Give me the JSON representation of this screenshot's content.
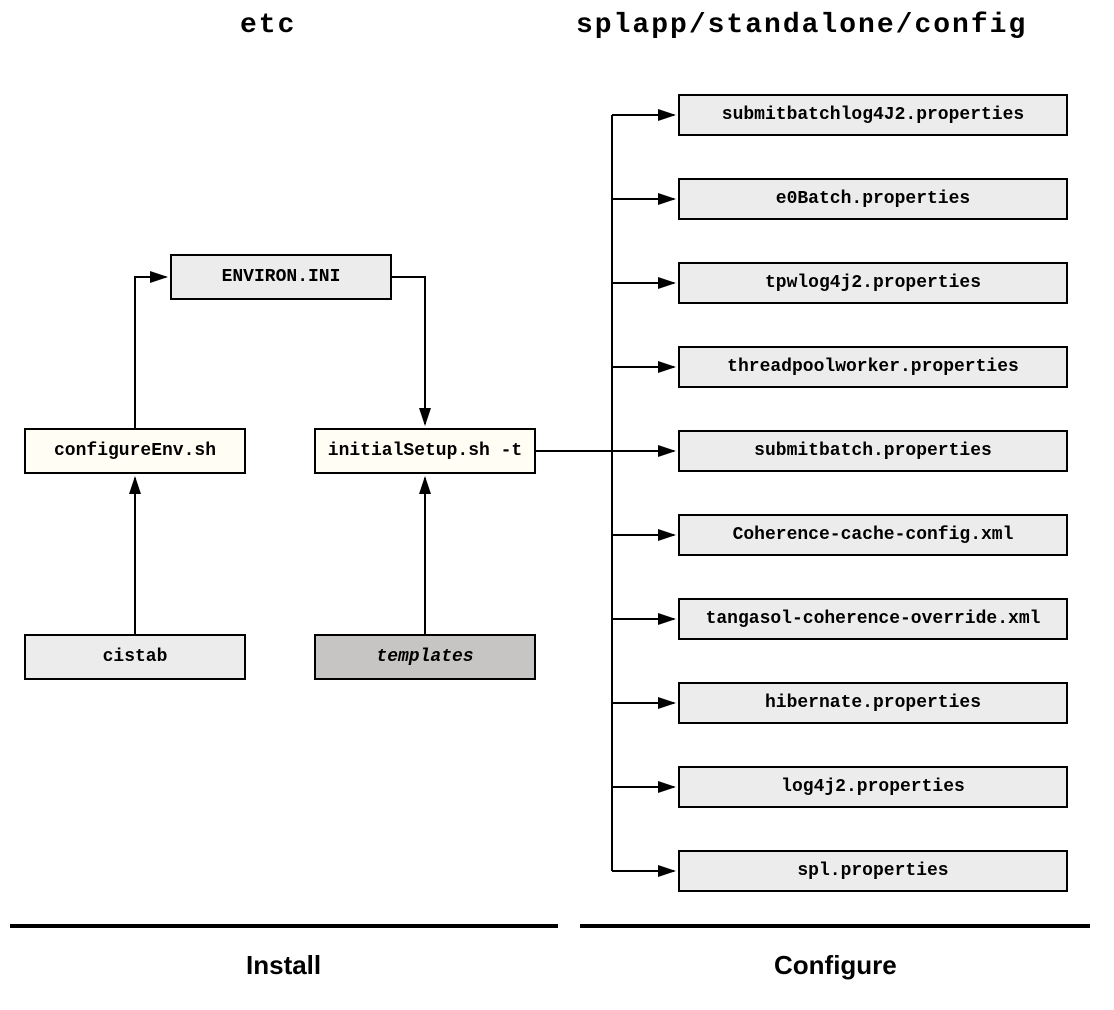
{
  "headers": {
    "left": "etc",
    "right": "splapp/standalone/config"
  },
  "install": {
    "environ": "ENVIRON.INI",
    "configureEnv": "configureEnv.sh",
    "initialSetup": "initialSetup.sh -t",
    "cistab": "cistab",
    "templates": "templates"
  },
  "configFiles": [
    "submitbatchlog4J2.properties",
    "e0Batch.properties",
    "tpwlog4j2.properties",
    "threadpoolworker.properties",
    "submitbatch.properties",
    "Coherence-cache-config.xml",
    "tangasol-coherence-override.xml",
    "hibernate.properties",
    "log4j2.properties",
    "spl.properties"
  ],
  "footers": {
    "left": "Install",
    "right": "Configure"
  }
}
